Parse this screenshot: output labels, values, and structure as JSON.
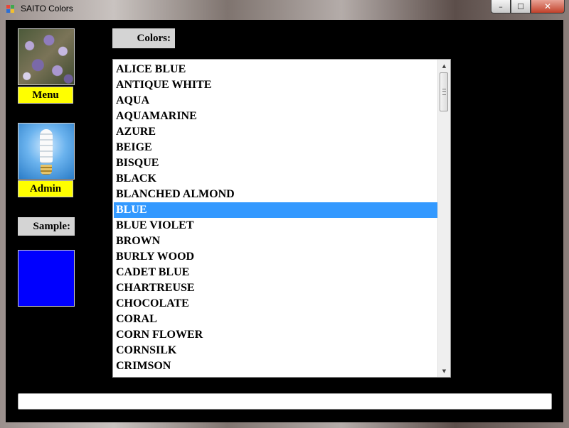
{
  "window": {
    "title": "SAITO Colors",
    "controls": {
      "minimize": "–",
      "maximize": "☐",
      "close": "✕"
    }
  },
  "sidebar": {
    "menu_button_label": "Menu",
    "admin_button_label": "Admin",
    "sample_label": "Sample:",
    "sample_color": "#0000ff"
  },
  "colors_label": "Colors:",
  "color_list": {
    "selected_index": 9,
    "items": [
      "ALICE BLUE",
      "ANTIQUE WHITE",
      "AQUA",
      "AQUAMARINE",
      "AZURE",
      "BEIGE",
      "BISQUE",
      "BLACK",
      "BLANCHED ALMOND",
      "BLUE",
      "BLUE VIOLET",
      "BROWN",
      "BURLY WOOD",
      "CADET BLUE",
      "CHARTREUSE",
      "CHOCOLATE",
      "CORAL",
      "CORN FLOWER",
      "CORNSILK",
      "CRIMSON"
    ],
    "selection_color": "#3399ff"
  },
  "status_field": {
    "value": ""
  },
  "theme": {
    "client_background": "#000000",
    "button_yellow": "#ffff00"
  }
}
